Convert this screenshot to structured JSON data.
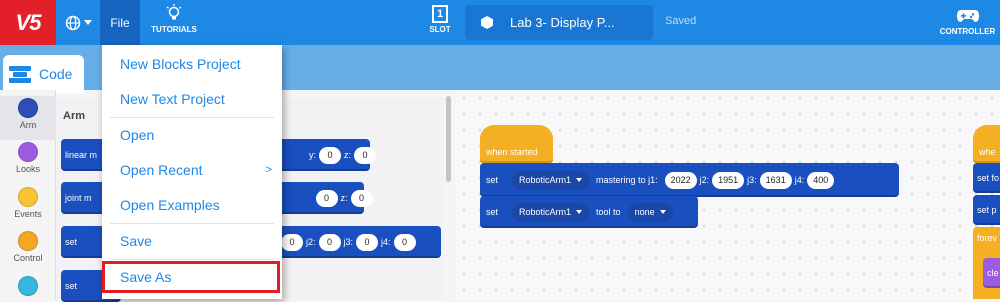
{
  "topbar": {
    "logo": "V5",
    "file_label": "File",
    "tutorials_label": "TUTORIALS",
    "slot_label": "SLOT",
    "slot_number": "1",
    "project_name": "Lab 3- Display P...",
    "save_status": "Saved",
    "controller_label": "CONTROLLER"
  },
  "tabs": {
    "code_label": "Code"
  },
  "categories": [
    {
      "label": "Arm",
      "color": "#2b4fb5"
    },
    {
      "label": "Looks",
      "color": "#9c5be0"
    },
    {
      "label": "Events",
      "color": "#f7c531"
    },
    {
      "label": "Control",
      "color": "#f5a623"
    },
    {
      "label": "",
      "color": "#37b6e0"
    }
  ],
  "palette": {
    "title": "Arm",
    "linear_label": "linear m",
    "joint_label": "joint m",
    "set_label": "set",
    "y_label": "y:",
    "y_val": "0",
    "z_label": "z:",
    "z_val": "0",
    "z2_label": "z:",
    "a_val": "0",
    "z2_val": "0",
    "j2_label": "j2:",
    "j2_val": "0",
    "j3_label": "j3:",
    "j3_val": "0",
    "j4_label": "j4:",
    "j4_val": "0",
    "j1_val": "0"
  },
  "file_menu": {
    "items": [
      {
        "label": "New Blocks Project"
      },
      {
        "label": "New Text Project"
      },
      {
        "label": "Open"
      },
      {
        "label": "Open Recent",
        "arrow": ">"
      },
      {
        "label": "Open Examples"
      },
      {
        "label": "Save"
      },
      {
        "label": "Save As"
      }
    ]
  },
  "workspace": {
    "hat_label": "when started",
    "block1": {
      "set": "set",
      "device": "RoboticArm1",
      "text": "mastering to j1:",
      "j1": "2022",
      "j2_label": "j2:",
      "j2": "1951",
      "j3_label": "j3:",
      "j3": "1631",
      "j4_label": "j4:",
      "j4": "400"
    },
    "block2": {
      "set": "set",
      "device": "RoboticArm1",
      "text": "tool to",
      "tool": "none"
    },
    "right_stack": {
      "hat": "whe",
      "b1": "set fo",
      "b2": "set p",
      "ctl": "forev",
      "inner": "cle"
    }
  }
}
